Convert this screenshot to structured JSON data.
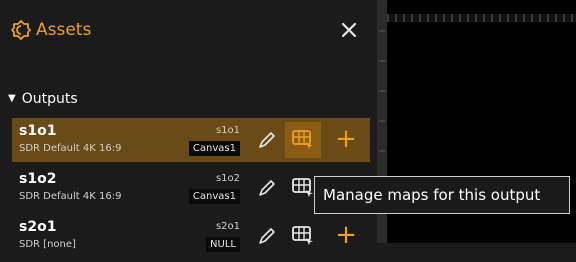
{
  "panel": {
    "title": "Assets",
    "app_icon": "assets-icon",
    "close_icon": "close-icon"
  },
  "outputs": {
    "label": "Outputs",
    "items": [
      {
        "name": "s1o1",
        "desc": "SDR  Default 4K 16:9",
        "code": "s1o1",
        "canvas": "Canvas1",
        "selected": true
      },
      {
        "name": "s1o2",
        "desc": "SDR  Default 4K 16:9",
        "code": "s1o2",
        "canvas": "Canvas1",
        "selected": false
      },
      {
        "name": "s2o1",
        "desc": "SDR  [none]",
        "code": "s2o1",
        "canvas": "NULL",
        "selected": false
      }
    ]
  },
  "tooltip": {
    "text": "Manage maps for this output"
  },
  "colors": {
    "accent": "#f0a020",
    "selected_row": "#6a4a16",
    "panel_bg": "#1b1b1b"
  }
}
